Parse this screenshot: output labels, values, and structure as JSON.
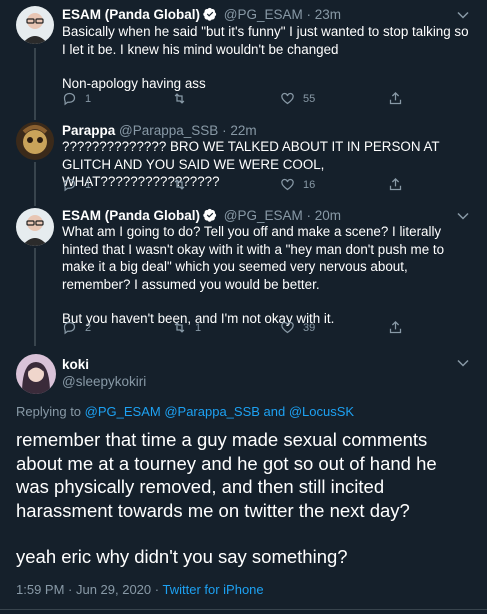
{
  "tweets": [
    {
      "name": "ESAM (Panda Global)",
      "handle": "@PG_ESAM",
      "time": "· 23m",
      "lines": [
        "Basically when he said \"but it's funny\" I just wanted to stop talking so I let it be. I knew his mind wouldn't be changed",
        "Non-apology having ass"
      ],
      "replies": "1",
      "retweets": "",
      "likes": "55"
    },
    {
      "name": "Parappa",
      "handle": "@Parappa_SSB",
      "time": "· 22m",
      "lines": [
        "?????????????? BRO WE TALKED ABOUT IT IN PERSON AT GLITCH AND YOU SAID WE WERE COOL, WHAT????????????????"
      ],
      "replies": "1",
      "retweets": "",
      "likes": "16"
    },
    {
      "name": "ESAM (Panda Global)",
      "handle": "@PG_ESAM",
      "time": "· 20m",
      "lines": [
        "What am I going to do? Tell you off and make a scene? I literally hinted that I wasn't okay with it with a \"hey man don't push me to make it a big deal\" which you seemed very nervous about, remember? I assumed you would be better.",
        "But you haven't been, and I'm not okay with it."
      ],
      "replies": "2",
      "retweets": "1",
      "likes": "39"
    }
  ],
  "focus": {
    "name": "koki",
    "handle": "@sleepykokiri",
    "replying_prefix": "Replying to",
    "replying_links": "@PG_ESAM @Parappa_SSB and @LocusSK",
    "lines": [
      "remember that time a guy made sexual comments about me at a tourney and he got so out of hand he was physically removed, and then still incited harassment towards me on twitter the next day?",
      "yeah eric why didn't you say something?"
    ],
    "timestamp": "1:59 PM · Jun 29, 2020 ·",
    "source": "Twitter for iPhone"
  },
  "icons": [
    "reply-icon",
    "retweet-icon",
    "like-icon",
    "share-icon",
    "verified-icon",
    "chevron-down-icon"
  ],
  "colors": {
    "background": "#15202b",
    "muted": "#8899a6",
    "link": "#1da1f2",
    "divider": "#38444d"
  }
}
